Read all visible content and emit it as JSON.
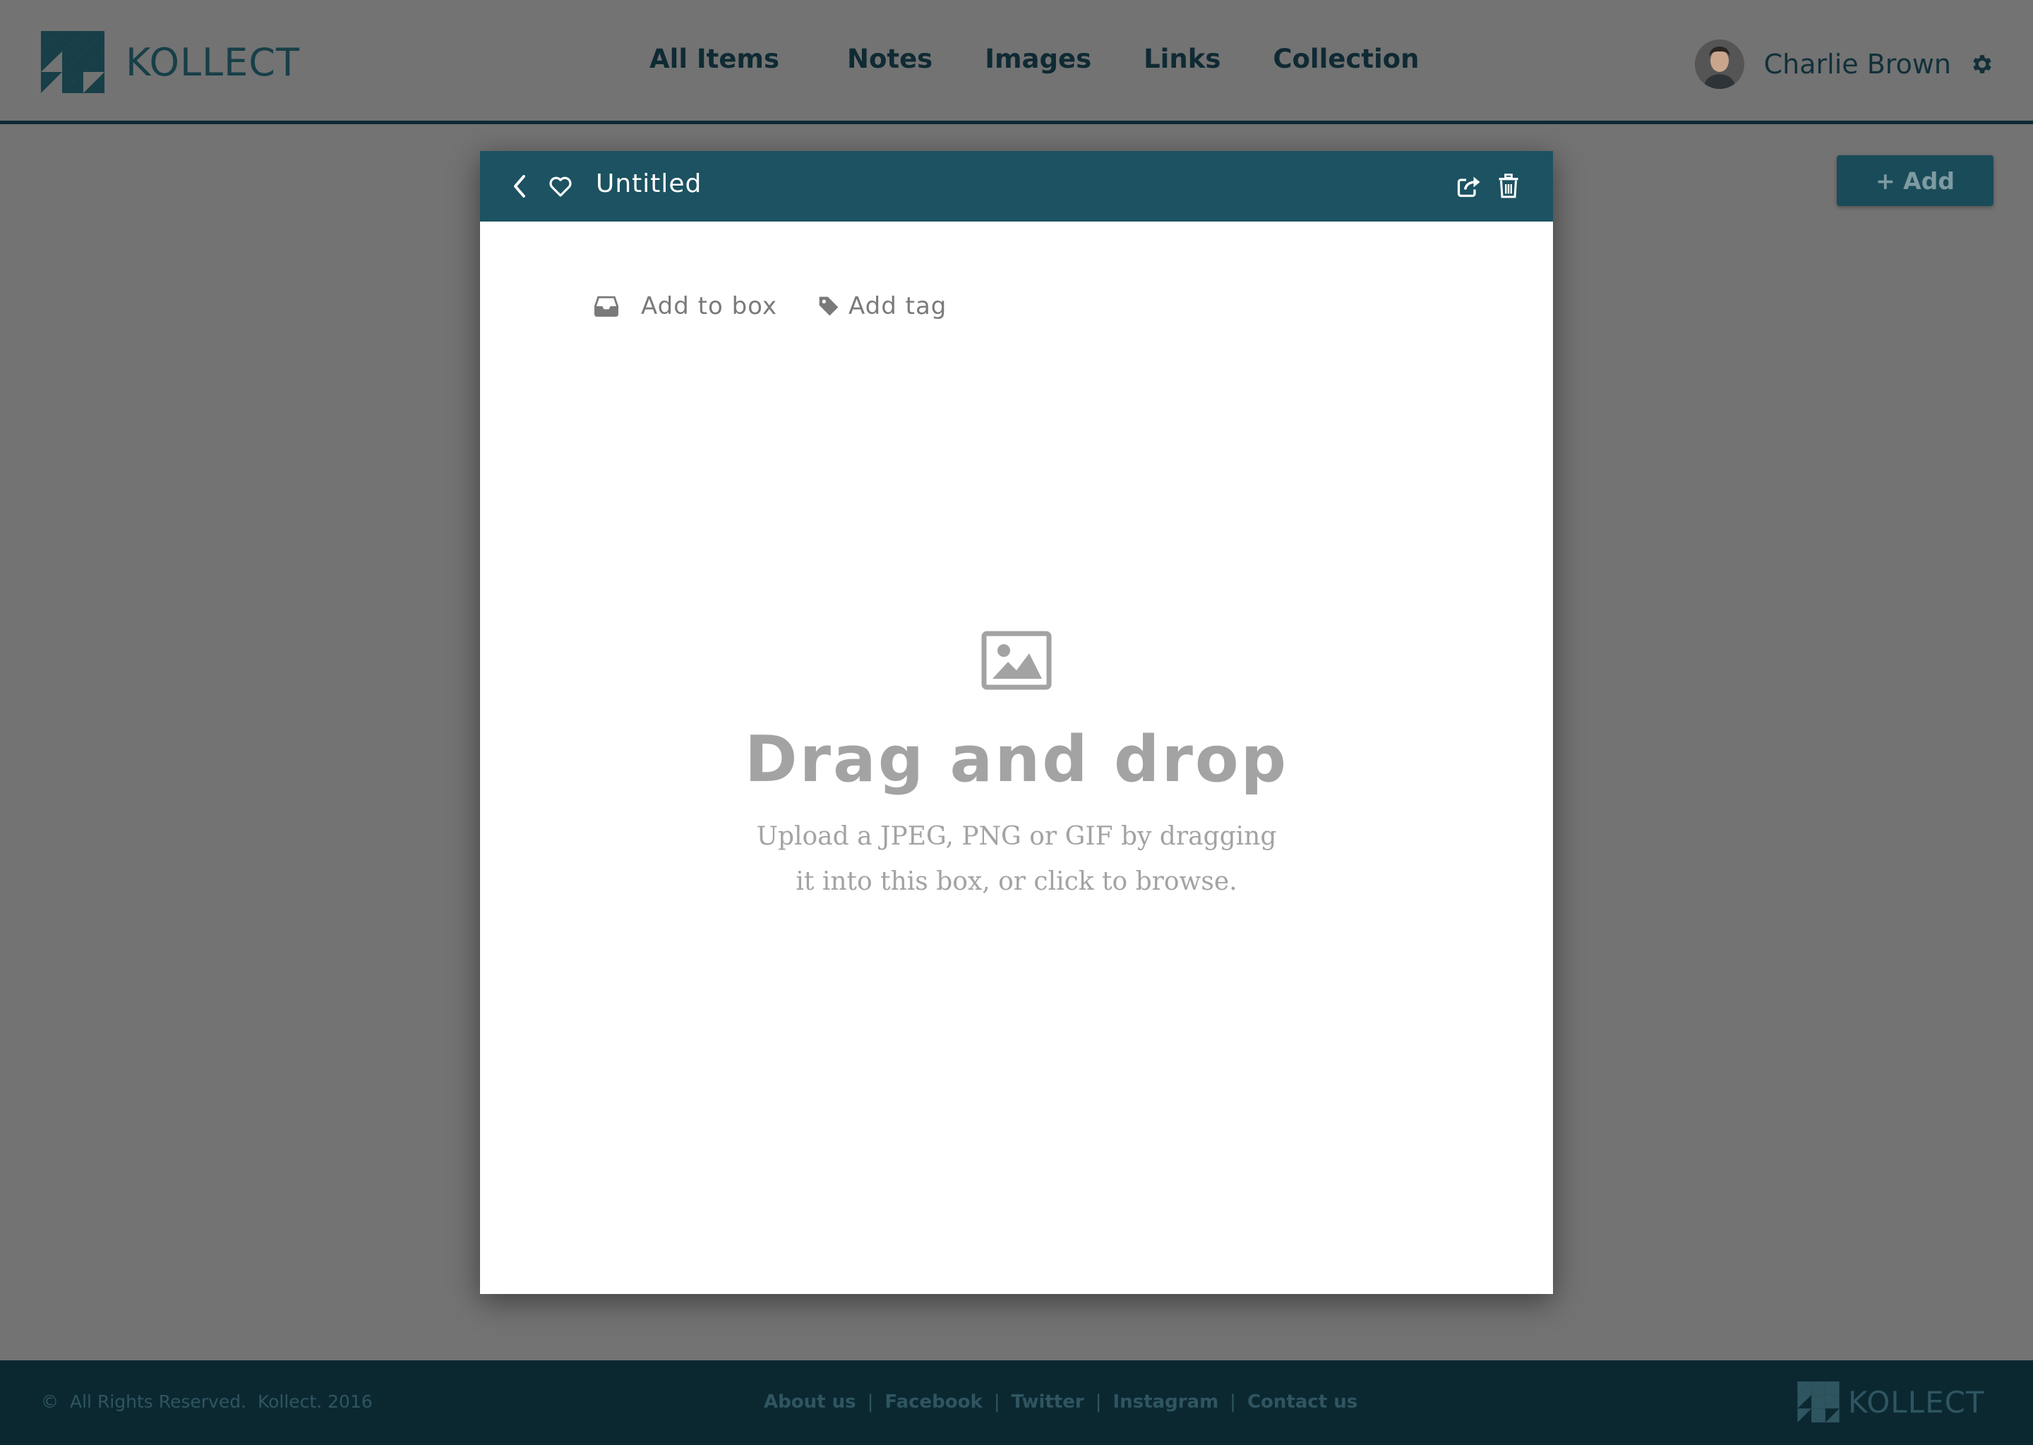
{
  "app": {
    "brand": "KOLLECT"
  },
  "nav": {
    "items": [
      "All Items",
      "Notes",
      "Images",
      "Links",
      "Collection"
    ]
  },
  "user": {
    "name": "Charlie Brown"
  },
  "toolbar": {
    "add_label": "+ Add"
  },
  "modal": {
    "title": "Untitled",
    "add_to_box_label": "Add to box",
    "add_tag_label": "Add tag",
    "drop_title": "Drag and drop",
    "drop_desc_line1": "Upload a JPEG, PNG or GIF by dragging",
    "drop_desc_line2": "it into this box, or click to browse."
  },
  "footer": {
    "copyright_symbol": "©",
    "copyright": "All Rights Reserved.  Kollect. 2016",
    "links": [
      "About us",
      "Facebook",
      "Twitter",
      "Instagram",
      "Contact us"
    ],
    "brand": "KOLLECT"
  },
  "colors": {
    "page_background": "#737373",
    "accent": "#1c5261",
    "footer_background": "#0b2831"
  },
  "icons": {
    "logo": "triangle-grid-logo-icon",
    "settings": "gear-icon",
    "back": "chevron-left-icon",
    "favorite": "heart-icon",
    "share": "share-icon",
    "delete": "trash-icon",
    "box": "inbox-icon",
    "tag": "tag-icon",
    "image": "image-icon"
  }
}
